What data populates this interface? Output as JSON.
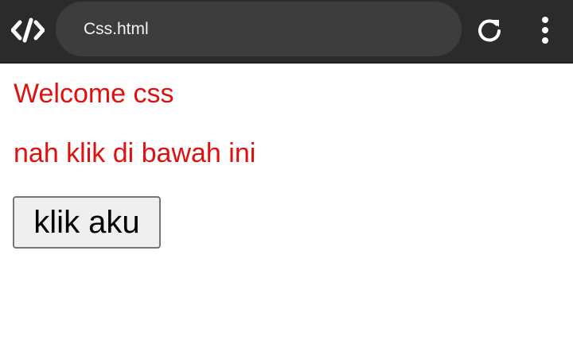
{
  "browser": {
    "address": "Css.html",
    "logo_icon": "code-brackets-icon",
    "reload_icon": "reload-icon",
    "menu_icon": "more-vertical-icon"
  },
  "page": {
    "heading": "Welcome css",
    "instruction": "nah klik di bawah ini",
    "button_label": "klik aku"
  },
  "colors": {
    "toolbar_bg": "#2b2b2b",
    "address_bg": "#3d3d3d",
    "text_red": "#e01010",
    "button_bg": "#efefef"
  }
}
